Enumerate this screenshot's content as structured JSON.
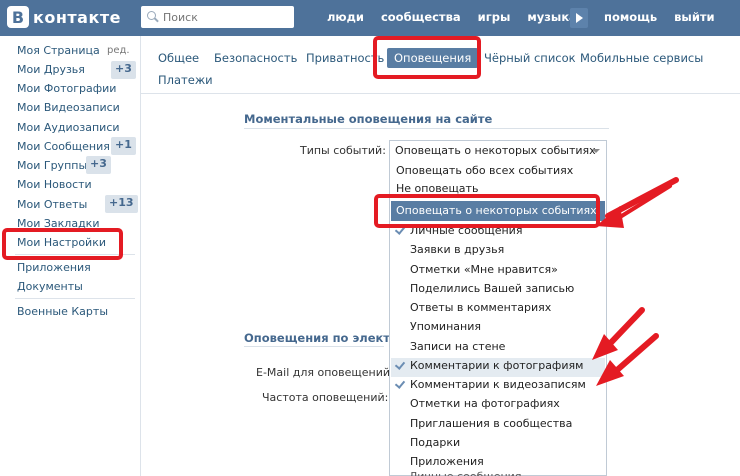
{
  "header": {
    "logo_letter": "В",
    "logo_text": "контакте",
    "search_placeholder": "Поиск",
    "nav": [
      "люди",
      "сообщества",
      "игры",
      "музыка"
    ],
    "nav_right": [
      "помощь",
      "выйти"
    ]
  },
  "sidebar": {
    "items": [
      {
        "label": "Моя Страница",
        "edit": "ред."
      },
      {
        "label": "Мои Друзья",
        "badge": "+3"
      },
      {
        "label": "Мои Фотографии"
      },
      {
        "label": "Мои Видеозаписи"
      },
      {
        "label": "Мои Аудиозаписи"
      },
      {
        "label": "Мои Сообщения",
        "badge": "+1"
      },
      {
        "label": "Мои Группы",
        "badge": "+3"
      },
      {
        "label": "Мои Новости"
      },
      {
        "label": "Мои Ответы",
        "badge": "+13"
      },
      {
        "label": "Мои Закладки"
      },
      {
        "label": "Мои Настройки"
      }
    ],
    "extra": [
      "Приложения",
      "Документы"
    ],
    "games": [
      "Военные Карты"
    ]
  },
  "tabs": [
    "Общее",
    "Безопасность",
    "Приватность",
    "Оповещения",
    "Чёрный список",
    "Мобильные сервисы",
    "Платежи"
  ],
  "section1": {
    "title": "Моментальные оповещения на сайте",
    "event_types_label": "Типы событий:",
    "selected_value": "Оповещать о некоторых событиях"
  },
  "section2": {
    "title": "Оповещения по электро",
    "email_label": "E-Mail для оповещений:",
    "frequency_label": "Частота оповещений:",
    "bottom_cut_text": "Личные сообщения"
  },
  "dropdown": {
    "options": [
      "Оповещать обо всех событиях",
      "Не оповещать",
      "Оповещать о некоторых событиях"
    ],
    "sub_options": [
      {
        "label": "Личные сообщения",
        "checked": true
      },
      {
        "label": "Заявки в друзья",
        "checked": false
      },
      {
        "label": "Отметки «Мне нравится»",
        "checked": false
      },
      {
        "label": "Поделились Вашей записью",
        "checked": false
      },
      {
        "label": "Ответы в комментариях",
        "checked": false
      },
      {
        "label": "Упоминания",
        "checked": false
      },
      {
        "label": "Записи на стене",
        "checked": false
      },
      {
        "label": "Комментарии к фотографиям",
        "checked": true
      },
      {
        "label": "Комментарии к видеозаписям",
        "checked": true
      },
      {
        "label": "Отметки на фотографиях",
        "checked": false
      },
      {
        "label": "Приглашения в сообщества",
        "checked": false
      },
      {
        "label": "Подарки",
        "checked": false
      },
      {
        "label": "Приложения",
        "checked": false
      }
    ]
  },
  "colors": {
    "brand": "#4e729a",
    "accent": "#597da3",
    "annotation": "#e41b23"
  }
}
